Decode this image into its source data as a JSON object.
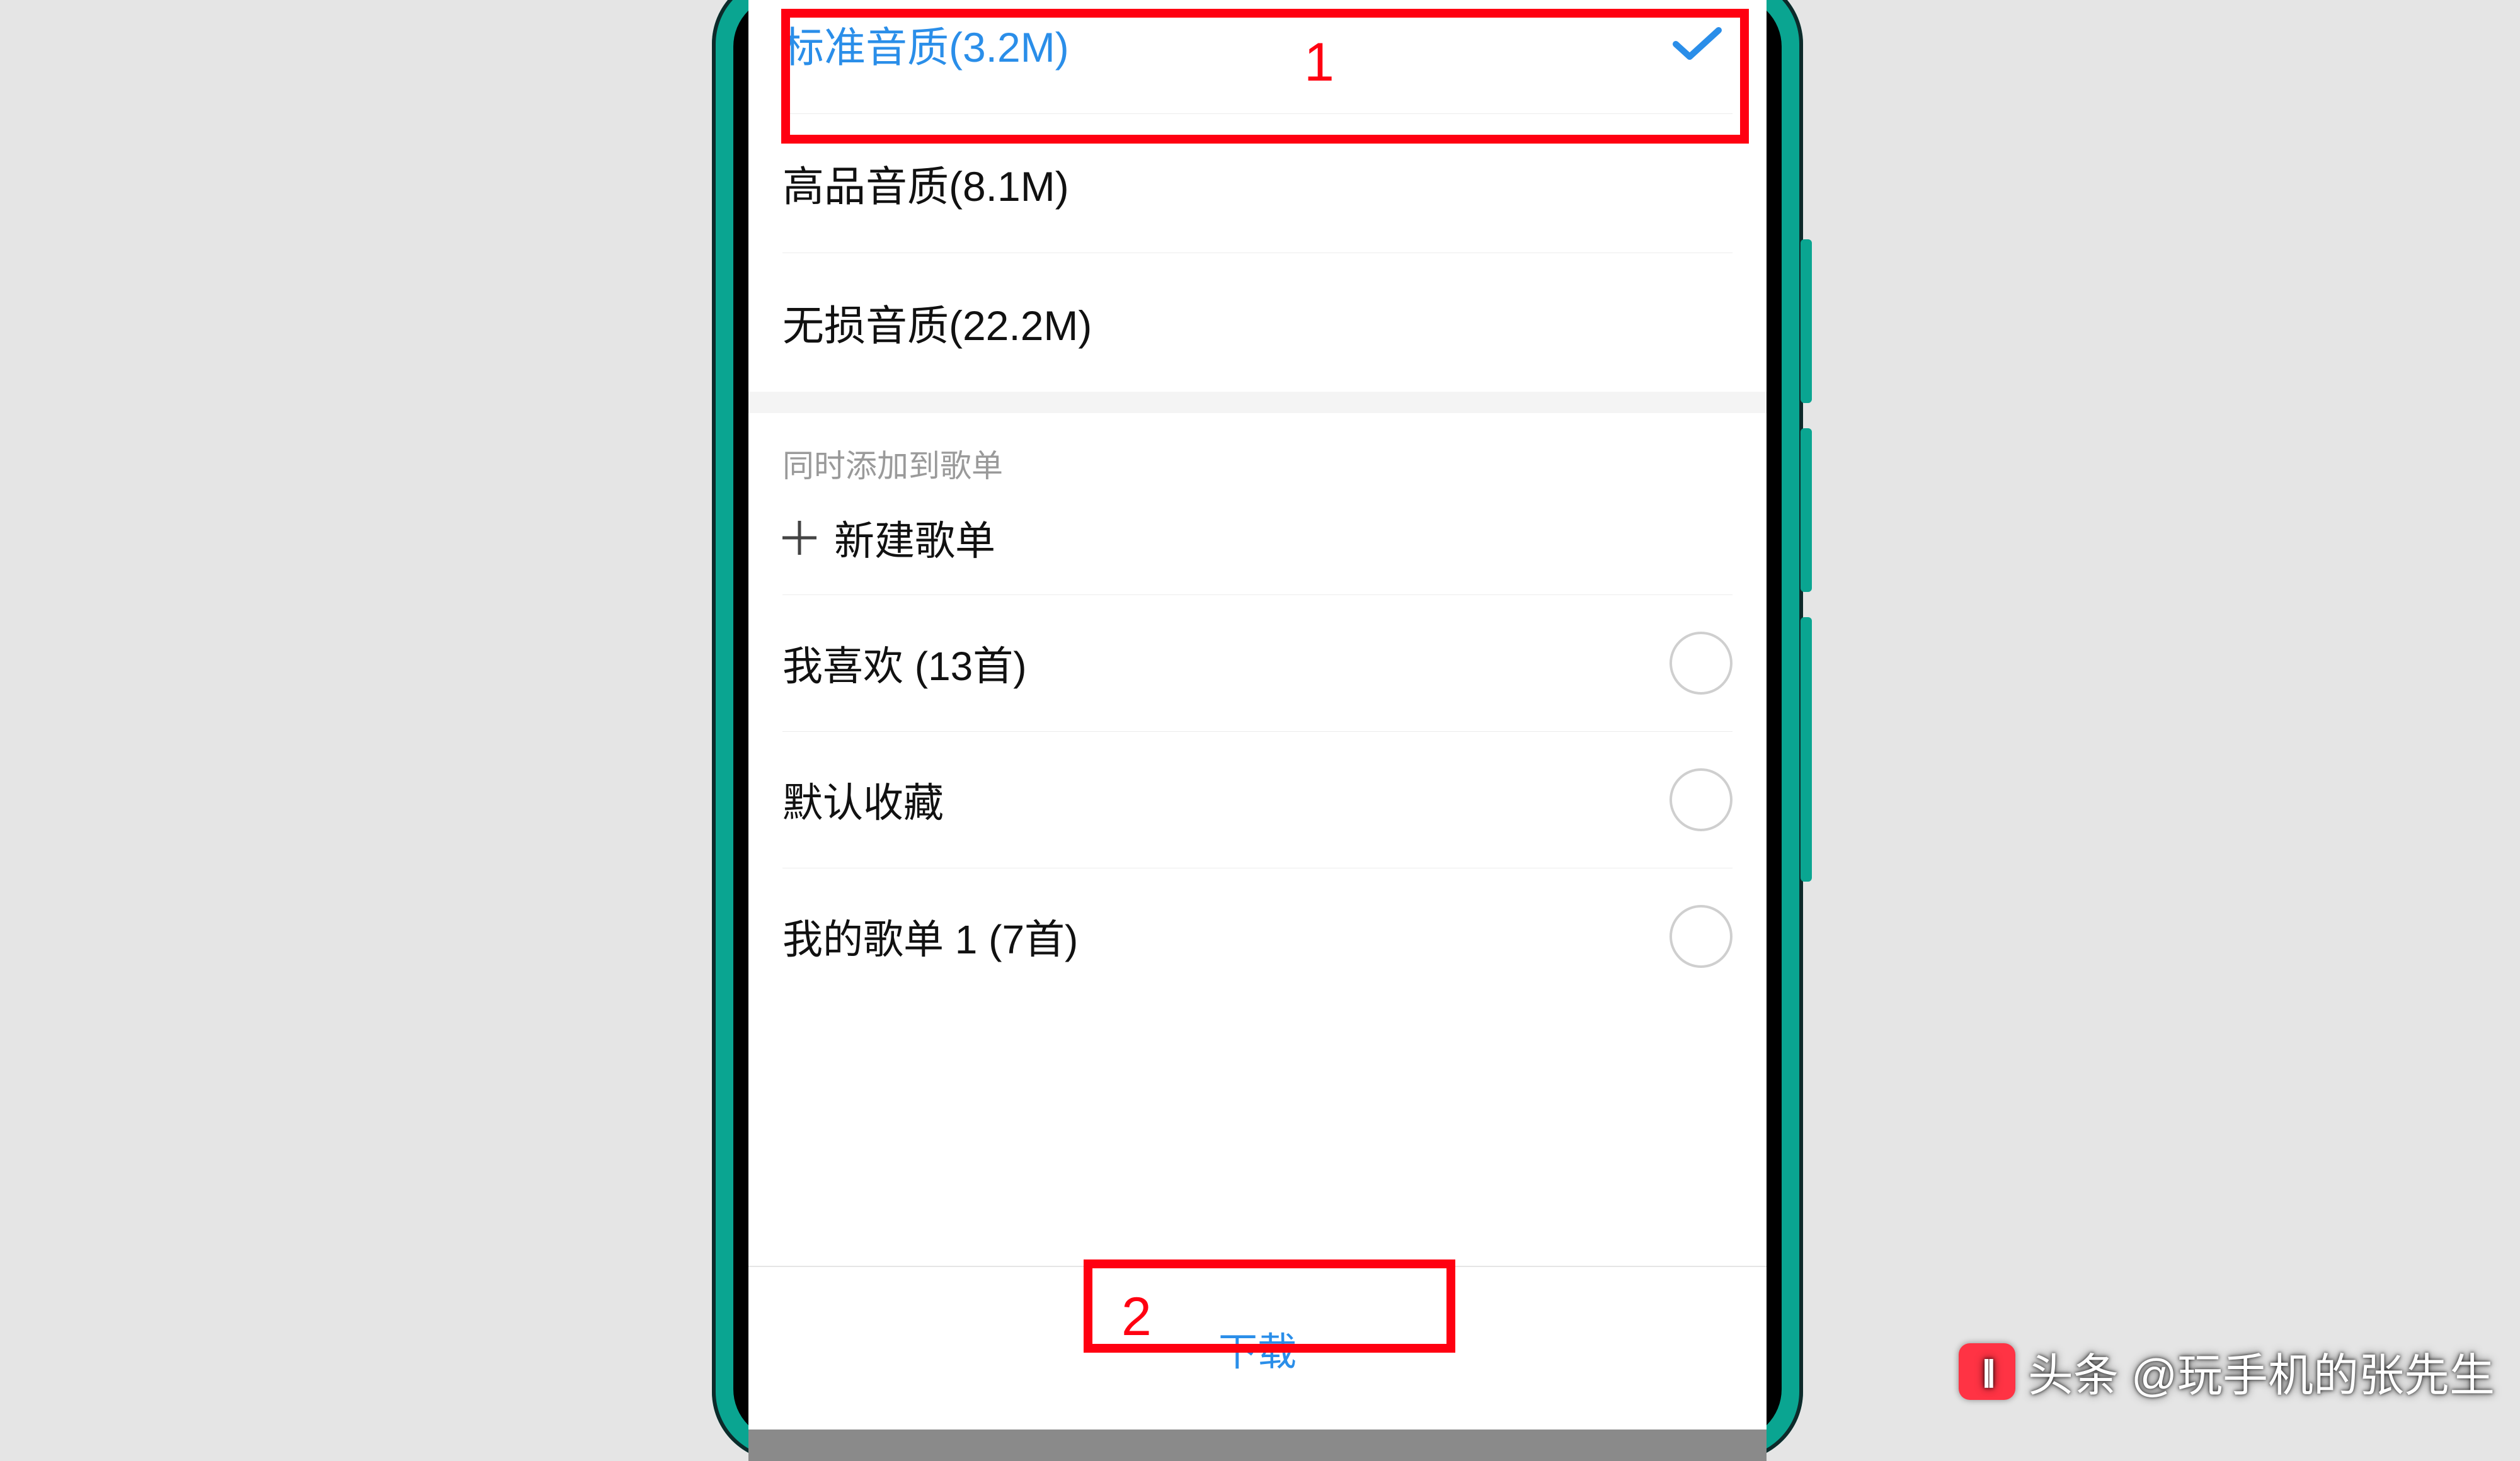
{
  "quality_options": [
    {
      "label": "标准音质(3.2M)",
      "selected": true
    },
    {
      "label": "高品音质(8.1M)",
      "selected": false
    },
    {
      "label": "无损音质(22.2M)",
      "selected": false
    }
  ],
  "playlist_section": {
    "header": "同时添加到歌单",
    "new_playlist_label": "新建歌单",
    "items": [
      {
        "label": "我喜欢 (13首)"
      },
      {
        "label": "默认收藏"
      },
      {
        "label": "我的歌单 1 (7首)"
      }
    ]
  },
  "download_label": "下载",
  "callouts": {
    "one": "1",
    "two": "2"
  },
  "watermark": {
    "prefix": "头条",
    "handle": "@玩手机的张先生"
  },
  "colors": {
    "accent": "#2a8ee9",
    "frame": "#0aa591",
    "callout": "#ff0011"
  }
}
